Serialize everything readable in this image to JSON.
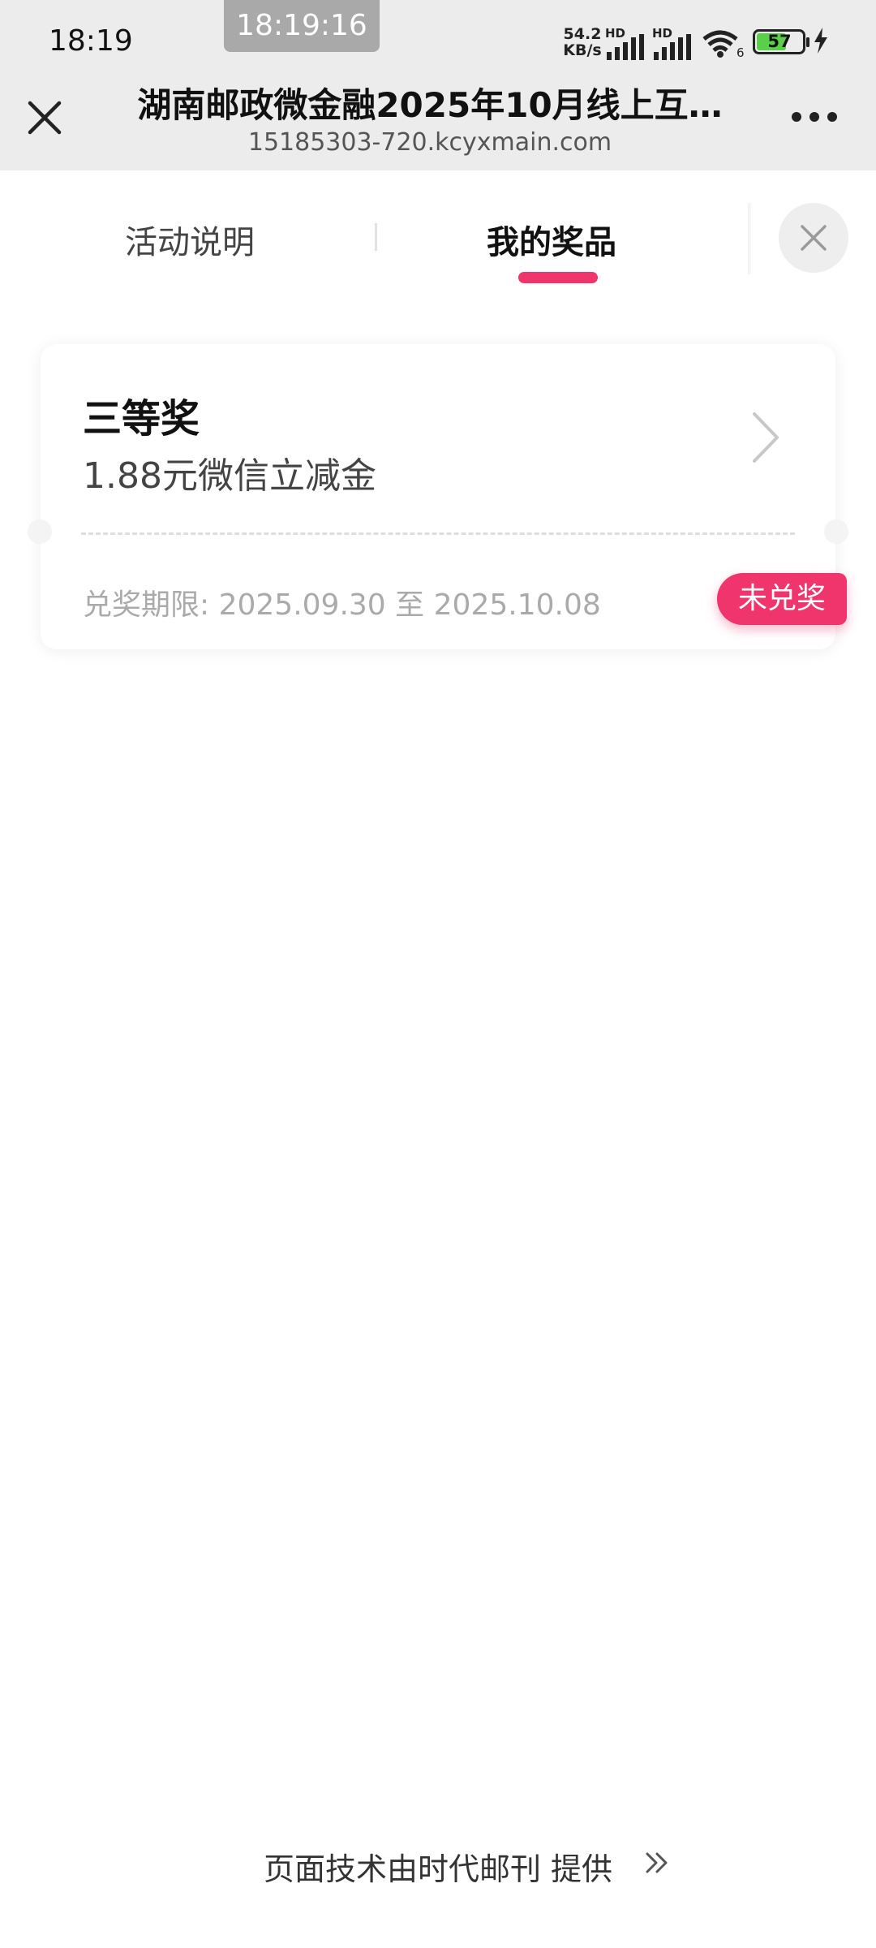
{
  "status_bar": {
    "time": "18:19",
    "screenshot_time": "18:19:16",
    "net_speed_value": "54.2",
    "net_speed_unit": "KB/s",
    "hd_label": "HD",
    "wifi_label": "6",
    "battery": "57"
  },
  "browser": {
    "title": "湖南邮政微金融2025年10月线上互…",
    "url": "15185303-720.kcyxmain.com"
  },
  "tabs": [
    {
      "label": "活动说明",
      "active": false
    },
    {
      "label": "我的奖品",
      "active": true
    }
  ],
  "prize": {
    "level": "三等奖",
    "name": "1.88元微信立减金",
    "period_label": "兑奖期限:",
    "period_start": "2025.09.30",
    "period_sep": "至",
    "period_end": "2025.10.08",
    "status": "未兑奖"
  },
  "footer": {
    "text": "页面技术由时代邮刊 提供"
  },
  "colors": {
    "accent": "#f0356c",
    "header_bg": "#ececec"
  }
}
